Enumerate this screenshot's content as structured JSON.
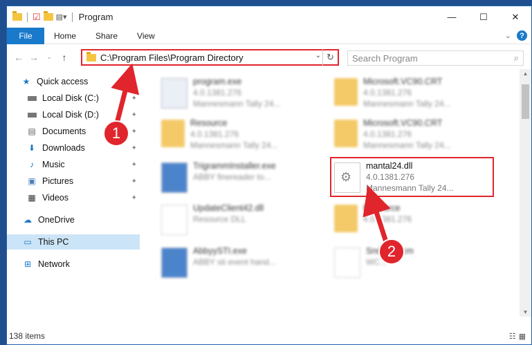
{
  "window": {
    "title": "Program"
  },
  "ribbon": {
    "tabs": [
      "File",
      "Home",
      "Share",
      "View"
    ],
    "help": "?"
  },
  "address": {
    "path": "C:\\Program Files\\Program Directory"
  },
  "search": {
    "placeholder": "Search Program"
  },
  "sidebar": {
    "items": [
      {
        "label": "Quick access",
        "icon": "star-icon"
      },
      {
        "label": "Local Disk (C:)",
        "icon": "drive-icon"
      },
      {
        "label": "Local Disk (D:)",
        "icon": "drive-icon"
      },
      {
        "label": "Documents",
        "icon": "documents-icon"
      },
      {
        "label": "Downloads",
        "icon": "downloads-icon"
      },
      {
        "label": "Music",
        "icon": "music-icon"
      },
      {
        "label": "Pictures",
        "icon": "pictures-icon"
      },
      {
        "label": "Videos",
        "icon": "videos-icon"
      },
      {
        "label": "OneDrive",
        "icon": "cloud-icon"
      },
      {
        "label": "This PC",
        "icon": "pc-icon"
      },
      {
        "label": "Network",
        "icon": "network-icon"
      }
    ]
  },
  "files": [
    {
      "name": "program.exe",
      "line2": "4.0.1381.276",
      "line3": "Mannesmann Tally 24..."
    },
    {
      "name": "Microsoft.VC90.CRT",
      "line2": "4.0.1381.276",
      "line3": "Mannesmann Tally 24..."
    },
    {
      "name": "Resource",
      "line2": "4.0.1381.276",
      "line3": "Mannesmann Tally 24..."
    },
    {
      "name": "Microsoft.VC90.CRT",
      "line2": "4.0.1381.276",
      "line3": "Mannesmann Tally 24..."
    },
    {
      "name": "TrigrammInstaller.exe",
      "line2": "ABBY finereader to...",
      "line3": ""
    },
    {
      "name": "mantal24.dll",
      "line2": "4.0.1381.276",
      "line3": "Mannesmann Tally 24..."
    },
    {
      "name": "UpdateClient42.dll",
      "line2": "Resource DLL",
      "line3": ""
    },
    {
      "name": "Resource",
      "line2": "4.0.1381.276",
      "line3": ""
    },
    {
      "name": "AbbyySTI.exe",
      "line2": "ABBY sti event hand...",
      "line3": ""
    },
    {
      "name": "Snd...4.wcm",
      "line2": "WC...",
      "line3": ""
    }
  ],
  "status": {
    "count": "138 items"
  },
  "badges": [
    "1",
    "2"
  ],
  "colors": {
    "accent": "#1979ca",
    "highlight": "#e0252c"
  }
}
